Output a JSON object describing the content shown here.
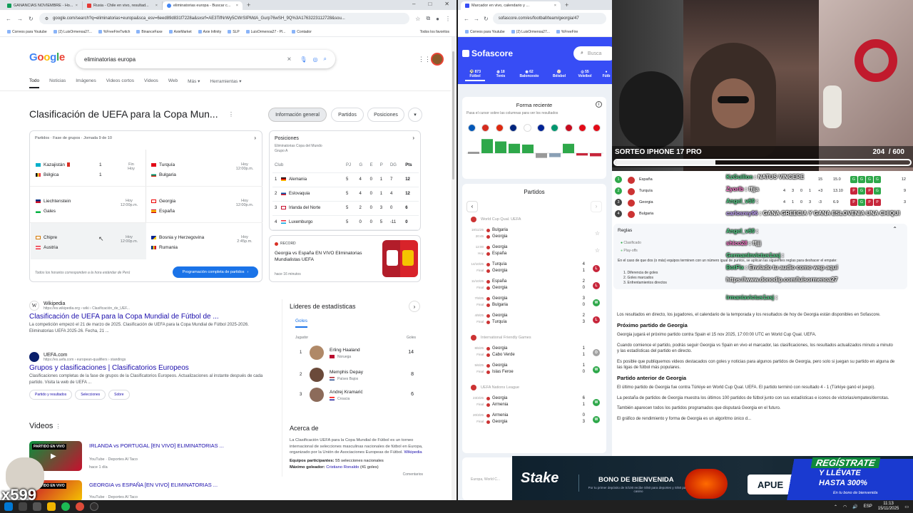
{
  "left_browser": {
    "tabs": [
      "GANANCIAS NOVIEMBRE - Ho...",
      "Rusia - Chile en vivo, resultad...",
      "eliminatorias europa - Buscar c..."
    ],
    "url": "google.com/search?q=eliminatorias+europa&sca_esv=6eed89d831f7228a&sxsrf=AE3TifNrWy5CWrSIPMdA_Gurp76wSH_9Q%3A1763223112728&sou...",
    "bookmarks": [
      "Correos para Youtube",
      "(2) LuisOrmenoa27...",
      "%FreeFireTwitch",
      "BinanceFaxe",
      "AxieMarket",
      "Axie Infinity",
      "SLP",
      "LuisOrmenoa27 - Pl...",
      "Contador",
      "Todos los favoritos"
    ],
    "logo": "Google",
    "search_query": "eliminatorias europa",
    "nav_tabs": [
      "Todo",
      "Noticias",
      "Imágenes",
      "Videos cortos",
      "Videos",
      "Web",
      "Más",
      "Herramientas"
    ],
    "heading": "Clasificación de UEFA para la Copa Mun...",
    "pills": [
      "Información general",
      "Partidos",
      "Posiciones"
    ],
    "matches_header": "Partidos · Fase de grupos · Jornada 9 de 10",
    "matches": [
      {
        "home": "Kazajistán",
        "away": "Bélgica",
        "hs": "1",
        "as": "1",
        "status": "Fin",
        "when": "Hoy"
      },
      {
        "home": "Turquía",
        "away": "Bulgaria",
        "hs": "",
        "as": "",
        "status": "Hoy",
        "when": "12:00p.m."
      },
      {
        "home": "Liechtenstein",
        "away": "Gales",
        "hs": "",
        "as": "",
        "status": "Hoy",
        "when": "12:00p.m."
      },
      {
        "home": "Georgia",
        "away": "España",
        "hs": "",
        "as": "",
        "status": "Hoy",
        "when": "12:00p.m."
      },
      {
        "home": "Chipre",
        "away": "Austria",
        "hs": "",
        "as": "",
        "status": "Hoy",
        "when": "12:00p.m."
      },
      {
        "home": "Bosnia y Herzegovina",
        "away": "Rumania",
        "hs": "",
        "as": "",
        "status": "Hoy",
        "when": "2:45p.m."
      }
    ],
    "matches_footer": "Todos los horarios corresponden a la hora estándar de Perú",
    "matches_button": "Programación completa de partidos",
    "standings_title": "Posiciones",
    "standings_sub": "Eliminatorias Copa del Mundo",
    "standings_group": "Grupo A",
    "standings_cols": [
      "Club",
      "PJ",
      "G",
      "E",
      "P",
      "DG",
      "Pts"
    ],
    "standings": [
      {
        "pos": "1",
        "club": "Alemania",
        "pj": "5",
        "g": "4",
        "e": "0",
        "p": "1",
        "dg": "7",
        "pts": "12"
      },
      {
        "pos": "2",
        "club": "Eslovaquia",
        "pj": "5",
        "g": "4",
        "e": "0",
        "p": "1",
        "dg": "4",
        "pts": "12"
      },
      {
        "pos": "3",
        "club": "Irlanda del Norte",
        "pj": "5",
        "g": "2",
        "e": "0",
        "p": "3",
        "dg": "0",
        "pts": "6"
      },
      {
        "pos": "4",
        "club": "Luxemburgo",
        "pj": "5",
        "g": "0",
        "e": "0",
        "p": "5",
        "dg": "-11",
        "pts": "0"
      }
    ],
    "record_label": "RECORD",
    "record_title": "Georgia vs España EN VIVO Eliminatorias Mundialistas UEFA",
    "record_time": "hace 16 minutos",
    "results": [
      {
        "site": "Wikipedia",
        "path": "https://es.wikipedia.org › wiki › Clasificación_de_UEF...",
        "title": "Clasificación de UEFA para la Copa Mundial de Fútbol de ...",
        "snippet": "La competición empezó el 21 de marzo de 2025. Clasificación de UEFA para la Copa Mundial de Fútbol 2025-2026. Eliminatorias UEFA 2025-26. Fecha, 21 ..."
      },
      {
        "site": "UEFA.com",
        "path": "https://es.uefa.com › european-qualifiers › standings",
        "title": "Grupos y clasificaciones | Clasificatorios Europeos",
        "snippet": "Clasificaciones completas de la fase de grupos de la Clasificatorios Europeos. Actualizaciones al instante después de cada partido. Visita la web de UEFA ..."
      }
    ],
    "chips": [
      "Partido y resultados",
      "Selecciones",
      "Sobre"
    ],
    "leaders_title": "Líderes de estadísticas",
    "leaders_tab": "Goles",
    "leaders_col_player": "Jugador",
    "leaders_col_goals": "Goles",
    "leaders": [
      {
        "rank": "1",
        "name": "Erling Haaland",
        "country": "Noruega",
        "goals": "14"
      },
      {
        "rank": "2",
        "name": "Memphis Depay",
        "country": "Países Bajos",
        "goals": "8"
      },
      {
        "rank": "3",
        "name": "Andrej Kramarić",
        "country": "Croacia",
        "goals": "6"
      }
    ],
    "videos_title": "Videos",
    "videos": [
      {
        "title": "IRLANDA vs PORTUGAL [EN VIVO] ELIMINATORIAS ...",
        "source": "YouTube · Deportes Al Taco",
        "age": "hace 1 día",
        "thumb_text": "PARTIDO EN VIVO"
      },
      {
        "title": "GEORGIA vs ESPAÑA [EN VIVO] ELIMINATORIAS ...",
        "source": "YouTube · Deportes Al Taco",
        "age": "",
        "thumb_text": "PARTIDO EN VIVO"
      }
    ],
    "about_title": "Acerca de",
    "about_text": "La Clasificación UEFA para la Copa Mundial de Fútbol es un torneo internacional de selecciones masculinas nacionales de fútbol en Europa, organizado por la Unión de Asociaciones Europeas de Fútbol.",
    "about_link": "Wikipedia",
    "about_participants_label": "Equipos participantes:",
    "about_participants": "55 selecciones nacionales",
    "about_scorer_label": "Máximo goleador:",
    "about_scorer": "Cristiano Ronaldo",
    "about_scorer_goals": "(41 goles)",
    "comments": "Comentarios"
  },
  "right_browser": {
    "tab": "Marcador en vivo, calendario y ...",
    "url": "sofascore.com/es/football/team/georgia/47",
    "bookmarks": [
      "Correos para Youtube",
      "(2) LuisOrmenoa27...",
      "%FreeFire"
    ],
    "logo": "Sofascore",
    "search_placeholder": "Busca",
    "sports": [
      {
        "count": "873",
        "name": "Fútbol"
      },
      {
        "count": "18",
        "name": "Tenis"
      },
      {
        "count": "62",
        "name": "Baloncesto"
      },
      {
        "count": "",
        "name": "Béisbol"
      },
      {
        "count": "55",
        "name": "Voleibol"
      },
      {
        "count": "",
        "name": "Fútb"
      }
    ],
    "form_title": "Forma reciente",
    "form_hint": "Pasa el cursor sobre las columnas para ver los resultados",
    "form_bars": [
      0.2,
      0.9,
      0.75,
      0.6,
      0.55,
      0.3,
      0.25,
      0.6,
      0.15,
      0.2
    ],
    "partidos_title": "Partidos",
    "groups": [
      {
        "name": "World Cup Qual. UEFA",
        "matches": [
          {
            "date": "18/11/25",
            "status": "20:45",
            "home": "Bulgaria",
            "away": "Georgia",
            "hs": "",
            "as": "",
            "res": ""
          },
          {
            "date": "12:00",
            "status": "Hoy",
            "home": "Georgia",
            "away": "España",
            "hs": "",
            "as": "",
            "res": ""
          },
          {
            "date": "14/10/25",
            "status": "Final",
            "home": "Turquía",
            "away": "Georgia",
            "hs": "4",
            "as": "1",
            "res": "L"
          },
          {
            "date": "11/10/25",
            "status": "Final",
            "home": "España",
            "away": "Georgia",
            "hs": "2",
            "as": "0",
            "res": "L"
          },
          {
            "date": "7/9/25",
            "status": "Final",
            "home": "Georgia",
            "away": "Bulgaria",
            "hs": "3",
            "as": "0",
            "res": "W"
          },
          {
            "date": "4/9/25",
            "status": "Final",
            "home": "Georgia",
            "away": "Turquía",
            "hs": "2",
            "as": "3",
            "res": "L"
          }
        ]
      },
      {
        "name": "International Friendly Games",
        "matches": [
          {
            "date": "8/6/25",
            "status": "Final",
            "home": "Georgia",
            "away": "Cabo Verde",
            "hs": "1",
            "as": "1",
            "res": "D"
          },
          {
            "date": "5/6/25",
            "status": "Final",
            "home": "Georgia",
            "away": "Islas Feroe",
            "hs": "1",
            "as": "0",
            "res": "W"
          }
        ]
      },
      {
        "name": "UEFA Nations League",
        "matches": [
          {
            "date": "23/3/25",
            "status": "Final",
            "home": "Georgia",
            "away": "Armenia",
            "hs": "6",
            "as": "1",
            "res": "W"
          },
          {
            "date": "20/3/25",
            "status": "Final",
            "home": "Armenia",
            "away": "Georgia",
            "hs": "0",
            "as": "3",
            "res": "W"
          }
        ]
      }
    ],
    "destacado": "Destacado",
    "europa_label": "Europa, World C..."
  },
  "overlay": {
    "sorteo_title": "SORTEO IPHONE 17 PRO",
    "sorteo_count": "204",
    "sorteo_total": "600",
    "sorteo_fraction": 0.34,
    "mini_table": [
      {
        "pos": "1",
        "team": "España",
        "pj": "",
        "g": "",
        "e": "",
        "p": "",
        "dg": "15",
        "pts": "15.0",
        "form": "GGGG",
        "last": "12"
      },
      {
        "pos": "2",
        "team": "Turquía",
        "pj": "4",
        "g": "3",
        "e": "0",
        "p": "1",
        "dg": "+3",
        "pts": "13.10",
        "form": "PGPG",
        "last": "9"
      },
      {
        "pos": "3",
        "team": "Georgia",
        "pj": "4",
        "g": "1",
        "e": "0",
        "p": "3",
        "dg": "-3",
        "pts": "6.9",
        "form": "PGPP",
        "last": "3"
      },
      {
        "pos": "4",
        "team": "Bulgaria",
        "pj": "",
        "g": "",
        "e": "",
        "p": "",
        "dg": "",
        "pts": "",
        "form": "",
        "last": ""
      }
    ],
    "reglas_title": "Reglas",
    "reglas_items": [
      "Clasificado",
      "Play-offs"
    ],
    "reglas_text": "En el caso de que dos (o más) equipos terminen con un número igual de puntos, se aplican las siguientes reglas para deshacer el empate:",
    "reglas_list": [
      "1. Diferencia de goles",
      "2. Goles marcados",
      "3. Enfrentamientos directos"
    ],
    "chat": [
      {
        "user": "KzGuillon",
        "msg": "NATUS VINCERE",
        "ucolor": "#58d68d"
      },
      {
        "user": "Zyorlb",
        "msg": "ffjja",
        "ucolor": "#ff7fd0"
      },
      {
        "user": "Angel_v69",
        "msg": "",
        "ucolor": "#58d68d"
      },
      {
        "user": "carlosrey96",
        "msg": "GANA GREECIA Y GANA ESLOVENIA UNA CHIQUI",
        "ucolor": "#c9a8ff"
      },
      {
        "user": "Angel_v69",
        "msg": "",
        "ucolor": "#58d68d"
      },
      {
        "user": "shico28",
        "msg": "ffjjj",
        "ucolor": "#ff7fd0"
      },
      {
        "user": "GermanInvictus1asj",
        "msg": "",
        "ucolor": "#58d68d"
      },
      {
        "user": "BotFix",
        "msg": "Enviado tu audio como wsp aquí",
        "ucolor": "#58d68d"
      },
      {
        "user": "",
        "msg": "https://www.donodip.com/luisormenoa27",
        "ucolor": "#fff"
      },
      {
        "user": "irmaniavictus1asj",
        "msg": "",
        "ucolor": "#58d68d"
      }
    ],
    "desc_paragraphs": [
      {
        "type": "p",
        "text": "Los resultados en directo, los jugadores, el calendario de la temporada y los resultados de hoy de Georgia están disponibles en Sofascore."
      },
      {
        "type": "h",
        "text": "Próximo partido de Georgia"
      },
      {
        "type": "p",
        "text": "Georgia jugará el próximo partido contra Spain el 15 nov 2025, 17:00:00 UTC en World Cup Qual. UEFA."
      },
      {
        "type": "p",
        "text": "Cuando comience el partido, podrás seguir Georgia vs Spain en vivo el marcador, las clasificaciones, los resultados actualizados minuto a minuto y las estadísticas del partido en directo."
      },
      {
        "type": "p",
        "text": "Es posible que publiquemos videos destacados con goles y noticias para algunos partidos de Georgia, pero solo si juegan su partido en alguna de las ligas de fútbol más populares."
      },
      {
        "type": "h",
        "text": "Partido anterior de Georgia"
      },
      {
        "type": "p",
        "text": "El último partido de Georgia fue contra Türkiye en World Cup Qual. UEFA. El partido terminó con resultado 4 - 1 (Türkiye ganó el juego)."
      },
      {
        "type": "p",
        "text": "La pestaña de partidos de Georgia muestra los últimos 100 partidos de fútbol junto con sus estadísticas e iconos de victorias/empates/derrotas."
      },
      {
        "type": "p",
        "text": "También aparecen todos los partidos programados que disputará Georgia en el futuro."
      },
      {
        "type": "p",
        "text": "El gráfico de rendimiento y forma de Georgia es un algoritmo único d..."
      }
    ],
    "stake_logo": "Stake",
    "stake_bono": "BONO DE BIENVENIDA",
    "stake_fine": "Por tu primer depósito de S/100 recibe S/50 para deportes y S/50 para casino",
    "stake_apuesta": "APUE",
    "stake_reg1": "REGÍSTRATE",
    "stake_reg2": "Y LLÉVATE",
    "stake_reg3": "HASTA 300%",
    "stake_reg4": "En tu bono de bienvenida",
    "x599": "x599"
  },
  "taskbar": {
    "time": "11:13",
    "date": "15/11/2025",
    "lang": "ESP"
  }
}
